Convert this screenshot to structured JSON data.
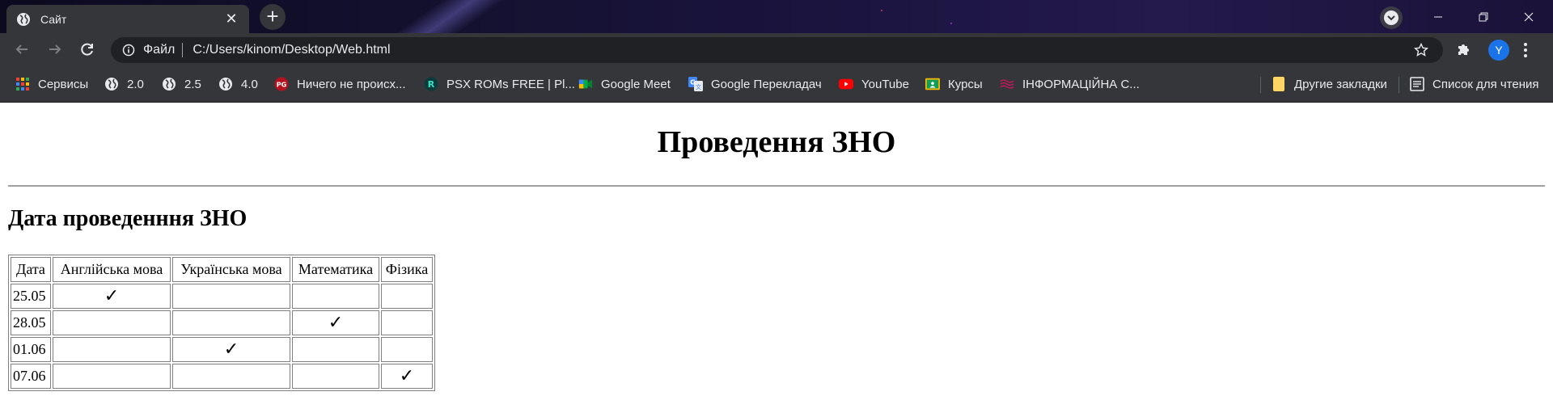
{
  "browser": {
    "tab": {
      "title": "Сайт"
    },
    "new_tab_label": "+",
    "omnibox": {
      "scheme": "Файл",
      "url": "C:/Users/kinom/Desktop/Web.html"
    },
    "avatar_letter": "Y"
  },
  "bookmarks": [
    {
      "label": "Сервисы",
      "icon": "apps-grid-icon"
    },
    {
      "label": "2.0",
      "icon": "globe-icon"
    },
    {
      "label": "2.5",
      "icon": "globe-icon"
    },
    {
      "label": "4.0",
      "icon": "globe-icon"
    },
    {
      "label": "Ничего не происх...",
      "icon": "pg-logo-icon"
    },
    {
      "label": "PSX ROMs FREE | Pl...",
      "icon": "r-logo-icon"
    },
    {
      "label": "Google Meet",
      "icon": "meet-icon"
    },
    {
      "label": "Google Перекладач",
      "icon": "translate-icon"
    },
    {
      "label": "YouTube",
      "icon": "youtube-icon"
    },
    {
      "label": "Курсы",
      "icon": "classroom-icon"
    },
    {
      "label": "ІНФОРМАЦІЙНА С...",
      "icon": "wave-logo-icon"
    },
    {
      "label": "Другие закладки",
      "icon": "folder-icon"
    },
    {
      "label": "Список для чтения",
      "icon": "reading-list-icon"
    }
  ],
  "page": {
    "heading": "Проведення ЗНО",
    "subheading": "Дата проведенння ЗНО",
    "table": {
      "headers": [
        "Дата",
        "Англійська мова",
        "Українська мова",
        "Математика",
        "Фізика"
      ],
      "rows": [
        [
          "25.05",
          "✓",
          "",
          "",
          ""
        ],
        [
          "28.05",
          "",
          "",
          "✓",
          ""
        ],
        [
          "01.06",
          "",
          "✓",
          "",
          ""
        ],
        [
          "07.06",
          "",
          "",
          "",
          "✓"
        ]
      ]
    }
  },
  "colors": {
    "tab_active": "#35363a",
    "omnibox_bg": "#202124",
    "accent_avatar": "#1a73e8",
    "youtube_red": "#ff0000"
  }
}
